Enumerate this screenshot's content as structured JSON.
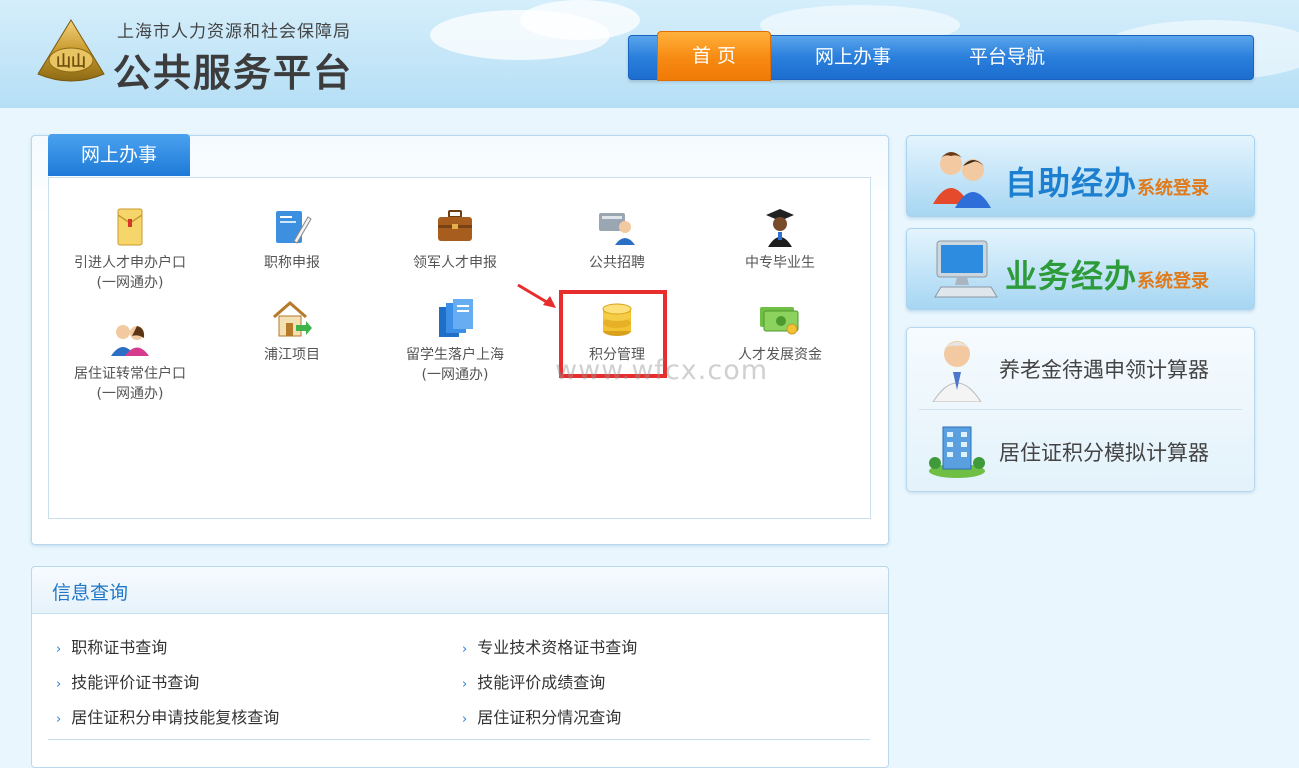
{
  "header": {
    "org_name": "上海市人力资源和社会保障局",
    "platform_name": "公共服务平台",
    "logo_text": "山山"
  },
  "nav": {
    "items": [
      {
        "label": "首 页",
        "active": true
      },
      {
        "label": "网上办事",
        "active": false
      },
      {
        "label": "平台导航",
        "active": false
      }
    ]
  },
  "online_services": {
    "tab_label": "网上办事",
    "items": [
      {
        "line1": "引进人才申办户口",
        "line2": "(一网通办)",
        "icon": "envelope-icon"
      },
      {
        "line1": "职称申报",
        "line2": "",
        "icon": "certificate-pen-icon"
      },
      {
        "line1": "领军人才申报",
        "line2": "",
        "icon": "briefcase-icon"
      },
      {
        "line1": "公共招聘",
        "line2": "",
        "icon": "recruiter-icon"
      },
      {
        "line1": "中专毕业生",
        "line2": "",
        "icon": "graduate-icon"
      },
      {
        "line1": "居住证转常住户口",
        "line2": "(一网通办)",
        "icon": "couple-icon"
      },
      {
        "line1": "浦江项目",
        "line2": "",
        "icon": "house-arrow-icon"
      },
      {
        "line1": "留学生落户上海",
        "line2": "(一网通办)",
        "icon": "books-icon"
      },
      {
        "line1": "积分管理",
        "line2": "",
        "icon": "coin-stack-icon"
      },
      {
        "line1": "人才发展资金",
        "line2": "",
        "icon": "money-icon"
      }
    ]
  },
  "watermark": "www.wfcx.com",
  "right": {
    "self_service": {
      "title": "自助经办",
      "sub": "系统登录"
    },
    "business": {
      "title": "业务经办",
      "sub": "系统登录"
    },
    "calculators": [
      {
        "label": "养老金待遇申领计算器",
        "icon": "elderly-man-icon"
      },
      {
        "label": "居住证积分模拟计算器",
        "icon": "building-icon"
      }
    ]
  },
  "info_query": {
    "title": "信息查询",
    "links": [
      "职称证书查询",
      "专业技术资格证书查询",
      "技能评价证书查询",
      "技能评价成绩查询",
      "居住证积分申请技能复核查询",
      "居住证积分情况查询"
    ]
  },
  "colors": {
    "nav_blue": "#2a7fdc",
    "nav_active_orange": "#f78a12",
    "highlight_red": "#e82d2d",
    "title_blue": "#1f78c8"
  }
}
